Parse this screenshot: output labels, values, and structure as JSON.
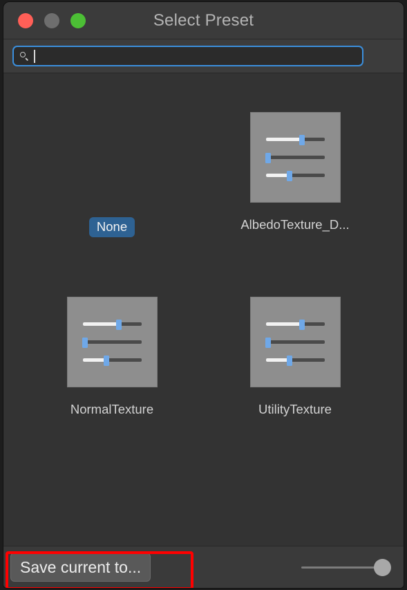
{
  "window": {
    "title": "Select Preset",
    "controls": [
      {
        "name": "close",
        "icon": "close-traffic-light",
        "color": "#ff5f57"
      },
      {
        "name": "minimize",
        "icon": "minimize-traffic-light",
        "color": "#6e6e6e"
      },
      {
        "name": "maximize",
        "icon": "maximize-traffic-light",
        "color": "#4cbf35"
      }
    ]
  },
  "search": {
    "icon": "search-icon",
    "value": "",
    "placeholder": "",
    "focused": true,
    "focus_color": "#3b8fdd"
  },
  "presets": [
    {
      "label": "None",
      "selected": true,
      "has_thumbnail": false
    },
    {
      "label": "AlbedoTexture_D...",
      "selected": false,
      "has_thumbnail": true,
      "thumbnail_icon": "sliders-preset-icon"
    },
    {
      "label": "NormalTexture",
      "selected": false,
      "has_thumbnail": true,
      "thumbnail_icon": "sliders-preset-icon"
    },
    {
      "label": "UtilityTexture",
      "selected": false,
      "has_thumbnail": true,
      "thumbnail_icon": "sliders-preset-icon"
    }
  ],
  "thumbnail_sliders": [
    {
      "fill_percent": 62,
      "knob_percent": 62
    },
    {
      "fill_percent": 0,
      "knob_percent": 4
    },
    {
      "fill_percent": 40,
      "knob_percent": 40
    }
  ],
  "footer": {
    "save_label": "Save current to...",
    "zoom_slider": {
      "icon": "zoom-slider",
      "value": 100
    }
  },
  "annotation": {
    "color": "#ff0000",
    "target": "save-current-to-button"
  },
  "colors": {
    "window_background": "#333333",
    "titlebar": "#3b3b3b",
    "toolbar": "#3c3c3c",
    "selection_blue": "#2e6293",
    "thumbnail_gray": "#8e8e8e",
    "slider_knob_blue": "#6fa8e8"
  }
}
